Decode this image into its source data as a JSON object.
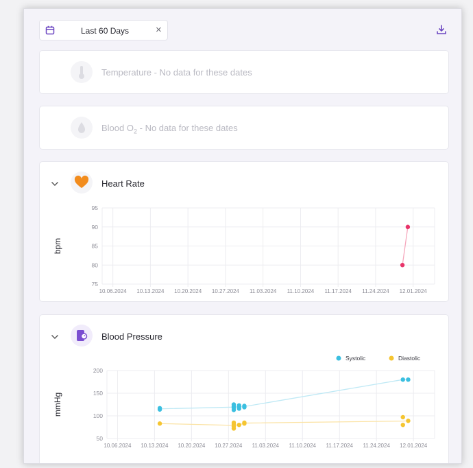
{
  "toolbar": {
    "date_range": "Last 60 Days",
    "clear_symbol": "×",
    "icons": {
      "calendar": "calendar-icon",
      "clear": "close-icon",
      "download": "download-icon"
    },
    "accent": "#6b46c1"
  },
  "cards": {
    "temperature": {
      "title": "Temperature",
      "status": "No data for these dates",
      "separator": " - ",
      "icon": "thermometer-icon"
    },
    "blood_o2": {
      "title": "Blood O",
      "subscript": "2",
      "status": "No data for these dates",
      "separator": " - ",
      "icon": "drop-icon"
    },
    "heart_rate": {
      "title": "Heart Rate",
      "icon": "heart-icon",
      "icon_color": "#f28c1d"
    },
    "blood_pressure": {
      "title": "Blood Pressure",
      "icon": "pressure-cuff-icon",
      "icon_color": "#7b4ed1"
    }
  },
  "chart_data": [
    {
      "type": "line",
      "title": "Heart Rate",
      "ylabel": "bpm",
      "xlabel": "",
      "ylim": [
        75,
        95
      ],
      "yticks": [
        "95",
        "90",
        "85",
        "80",
        "75"
      ],
      "xticks": [
        "10.06.2024",
        "10.13.2024",
        "10.20.2024",
        "10.27.2024",
        "11.03.2024",
        "11.10.2024",
        "11.17.2024",
        "11.24.2024",
        "12.01.2024"
      ],
      "xlim": [
        "2024-10-04",
        "2024-12-05"
      ],
      "grid": true,
      "legend": "none",
      "series": [
        {
          "color": "#e8346a",
          "line_color": "#f6a8bd",
          "points": [
            [
              "2024-11-29",
              80
            ],
            [
              "2024-11-30",
              90
            ]
          ]
        }
      ]
    },
    {
      "type": "line",
      "title": "Blood Pressure",
      "ylabel": "mmHg",
      "xlabel": "",
      "ylim": [
        50,
        200
      ],
      "yticks": [
        "200",
        "150",
        "100",
        "50"
      ],
      "xticks": [
        "10.06.2024",
        "10.13.2024",
        "10.20.2024",
        "10.27.2024",
        "11.03.2024",
        "11.10.2024",
        "11.17.2024",
        "11.24.2024",
        "12.01.2024"
      ],
      "xlim": [
        "2024-10-04",
        "2024-12-05"
      ],
      "grid": true,
      "legend": "top-right",
      "series": [
        {
          "name": "Systolic",
          "color": "#3bbfe0",
          "line_color": "#bfe9f5",
          "points": [
            [
              "2024-10-14",
              114
            ],
            [
              "2024-10-14",
              117
            ],
            [
              "2024-10-28",
              113
            ],
            [
              "2024-10-28",
              118
            ],
            [
              "2024-10-28",
              121
            ],
            [
              "2024-10-28",
              125
            ],
            [
              "2024-10-29",
              116
            ],
            [
              "2024-10-29",
              120
            ],
            [
              "2024-10-29",
              123
            ],
            [
              "2024-10-30",
              119
            ],
            [
              "2024-10-30",
              122
            ],
            [
              "2024-11-29",
              180
            ],
            [
              "2024-11-30",
              180
            ]
          ]
        },
        {
          "name": "Diastolic",
          "color": "#f5c531",
          "line_color": "#fbe3a5",
          "points": [
            [
              "2024-10-14",
              83
            ],
            [
              "2024-10-28",
              72
            ],
            [
              "2024-10-28",
              77
            ],
            [
              "2024-10-28",
              82
            ],
            [
              "2024-10-28",
              85
            ],
            [
              "2024-10-29",
              80
            ],
            [
              "2024-10-30",
              83
            ],
            [
              "2024-10-30",
              85
            ],
            [
              "2024-11-29",
              80
            ],
            [
              "2024-11-29",
              97
            ],
            [
              "2024-11-30",
              89
            ]
          ]
        }
      ]
    }
  ]
}
